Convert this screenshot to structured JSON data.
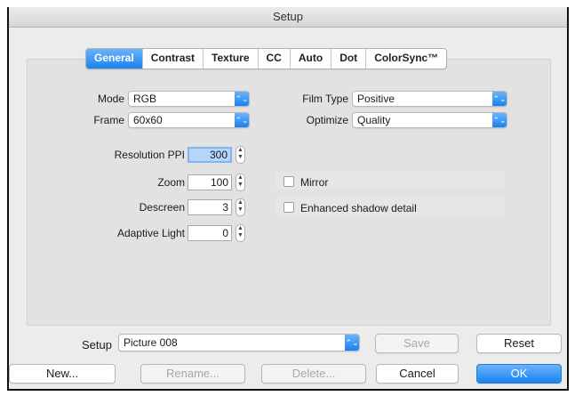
{
  "window": {
    "title": "Setup"
  },
  "tabs": [
    "General",
    "Contrast",
    "Texture",
    "CC",
    "Auto",
    "Dot",
    "ColorSync™"
  ],
  "active_tab": "General",
  "fields": {
    "mode": {
      "label": "Mode",
      "value": "RGB"
    },
    "frame": {
      "label": "Frame",
      "value": "60x60"
    },
    "film_type": {
      "label": "Film Type",
      "value": "Positive"
    },
    "optimize": {
      "label": "Optimize",
      "value": "Quality"
    },
    "resolution": {
      "label": "Resolution PPI",
      "value": "300"
    },
    "zoom": {
      "label": "Zoom",
      "value": "100"
    },
    "descreen": {
      "label": "Descreen",
      "value": "3"
    },
    "adaptive_light": {
      "label": "Adaptive Light",
      "value": "0"
    }
  },
  "checkboxes": {
    "mirror": {
      "label": "Mirror",
      "checked": false
    },
    "enhanced_shadow": {
      "label": "Enhanced shadow detail",
      "checked": false
    }
  },
  "setup": {
    "label": "Setup",
    "value": "Picture 008"
  },
  "buttons": {
    "save": "Save",
    "reset": "Reset",
    "new": "New...",
    "rename": "Rename...",
    "delete": "Delete...",
    "cancel": "Cancel",
    "ok": "OK"
  },
  "icons": {
    "popup": "up-down-chevron-icon",
    "stepper": "stepper-arrows-icon"
  },
  "colors": {
    "accent": "#1a82f0",
    "selection": "#b4d5fc"
  }
}
